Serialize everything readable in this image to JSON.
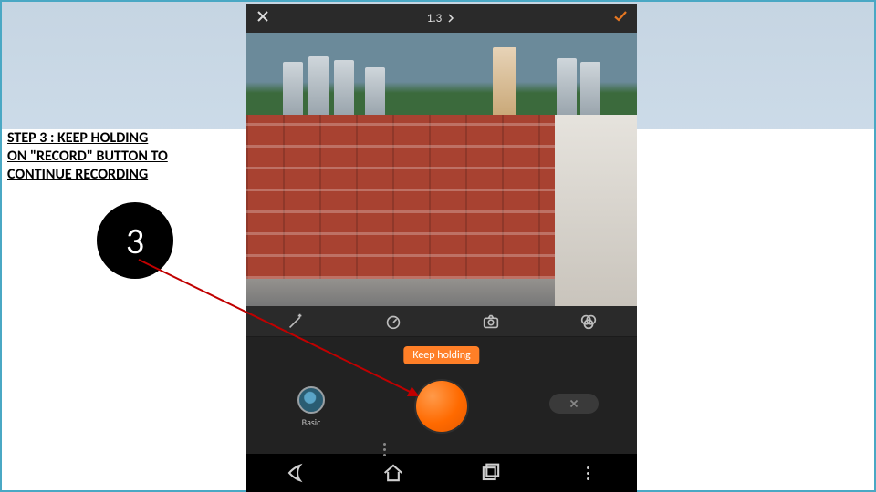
{
  "instruction": {
    "text": "STEP 3 : KEEP HOLDING\nON \"RECORD\" BUTTON TO\nCONTINUE RECORDING",
    "badge": "3"
  },
  "camera": {
    "top": {
      "zoom_label": "1.3"
    },
    "icon_row": [
      "wand-icon",
      "speed-icon",
      "camera-flip-icon",
      "filter-icon"
    ],
    "controls": {
      "tooltip": "Keep holding",
      "mode_label": "Basic"
    }
  },
  "navbar": {
    "items": [
      "back",
      "home",
      "recent",
      "menu"
    ]
  },
  "colors": {
    "accent": "#ff7f27",
    "confirm": "#e67722",
    "arrow": "#c00000"
  }
}
